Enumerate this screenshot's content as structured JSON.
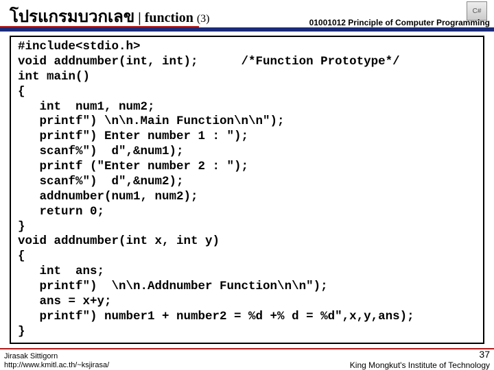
{
  "header": {
    "title_thai": "โปรแกรมบวกเลข",
    "title_sep": " | ",
    "title_sub": "function ",
    "title_num": "(3)",
    "course": "01001012 Principle of Computer Programming",
    "logo": "C#"
  },
  "code": "#include<stdio.h>\nvoid addnumber(int, int);      /*Function Prototype*/\nint main()\n{\n   int  num1, num2;\n   printf\") \\n\\n.Main Function\\n\\n\");\n   printf\") Enter number 1 : \");\n   scanf%\")  d\",&num1);\n   printf (\"Enter number 2 : \");\n   scanf%\")  d\",&num2);\n   addnumber(num1, num2);\n   return 0;\n}\nvoid addnumber(int x, int y)\n{\n   int  ans;\n   printf\")  \\n\\n.Addnumber Function\\n\\n\");\n   ans = x+y;\n   printf\") number1 + number2 = %d +% d = %d\",x,y,ans);\n}",
  "footer": {
    "author": "Jirasak Sittigorn",
    "url": "http://www.kmitl.ac.th/~ksjirasa/",
    "institute": "King Mongkut's Institute of Technology",
    "slide_num": "37"
  }
}
